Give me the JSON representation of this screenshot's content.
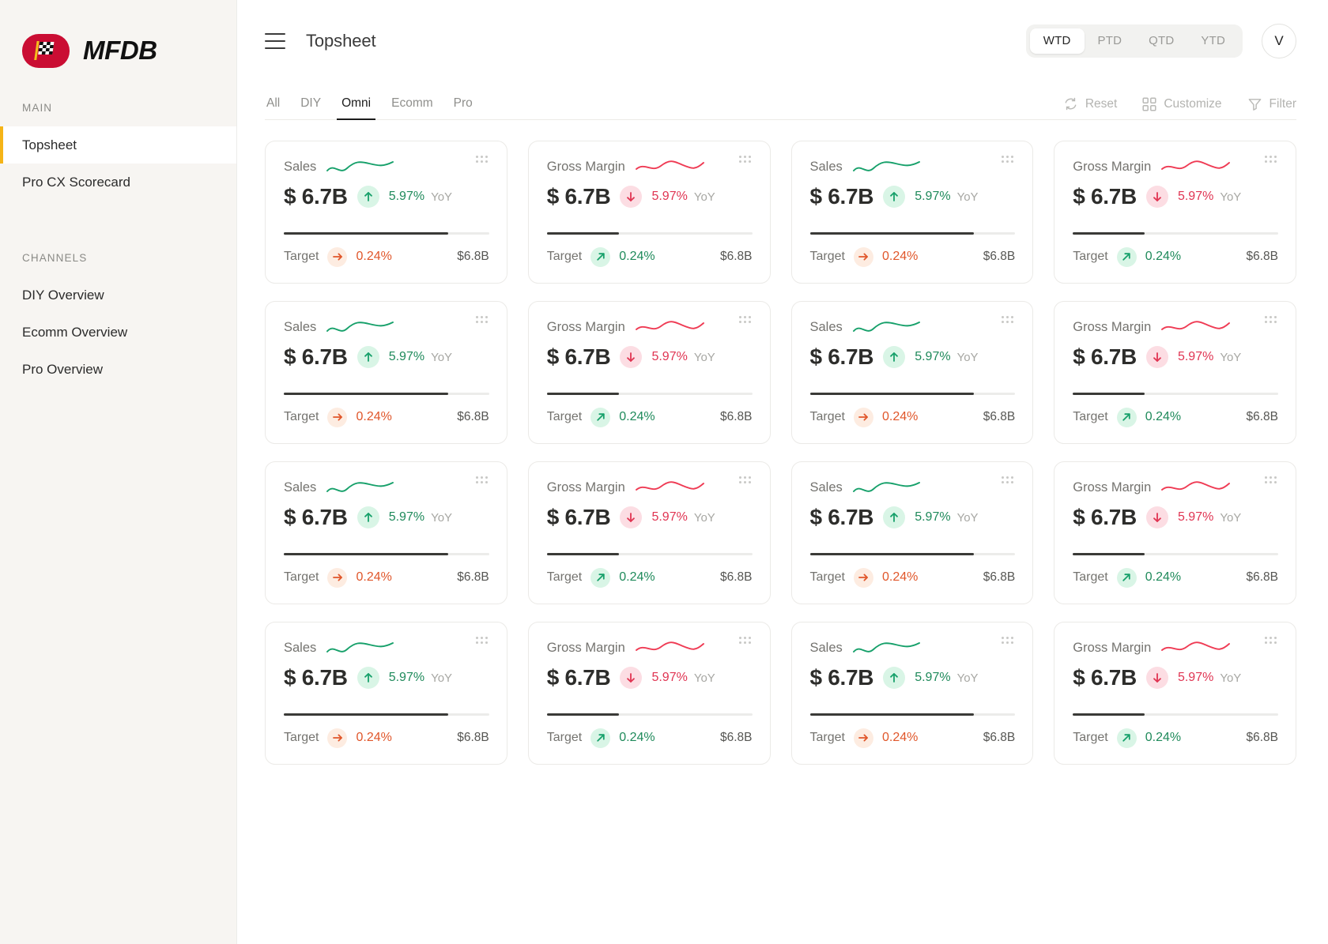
{
  "sidebar": {
    "brand": {
      "name": "MFDB",
      "logo_icon": "checkered-flag-icon",
      "logo_color": "#ca0d33"
    },
    "sections": [
      {
        "label": "MAIN",
        "items": [
          {
            "label": "Topsheet",
            "active": true
          },
          {
            "label": "Pro CX Scorecard",
            "active": false
          }
        ]
      },
      {
        "label": "CHANNELS",
        "items": [
          {
            "label": "DIY Overview",
            "active": false
          },
          {
            "label": "Ecomm Overview",
            "active": false
          },
          {
            "label": "Pro Overview",
            "active": false
          }
        ]
      }
    ],
    "active_accent": "#f5b417"
  },
  "header": {
    "menu_icon": "hamburger-icon",
    "title": "Topsheet",
    "period_options": [
      "WTD",
      "PTD",
      "QTD",
      "YTD"
    ],
    "period_selected": "WTD",
    "avatar_initial": "V"
  },
  "tabs": {
    "items": [
      "All",
      "DIY",
      "Omni",
      "Ecomm",
      "Pro"
    ],
    "selected": "Omni"
  },
  "toolbar": {
    "reset_label": "Reset",
    "customize_label": "Customize",
    "filter_label": "Filter"
  },
  "colors": {
    "positive": "#1f8a5b",
    "negative": "#e03452",
    "warning": "#e0562a",
    "bar": "#3a3a37"
  },
  "cards": [
    {
      "label": "Sales",
      "value": "$ 6.7B",
      "delta": "5.97%",
      "delta_dir": "up",
      "yoy": "YoY",
      "spark": "up",
      "target_label": "Target",
      "target_delta": "0.24%",
      "target_dir": "flat",
      "target_value": "$6.8B",
      "progress": 80
    },
    {
      "label": "Gross Margin",
      "value": "$ 6.7B",
      "delta": "5.97%",
      "delta_dir": "down",
      "yoy": "YoY",
      "spark": "down",
      "target_label": "Target",
      "target_delta": "0.24%",
      "target_dir": "upright",
      "target_value": "$6.8B",
      "progress": 35
    },
    {
      "label": "Sales",
      "value": "$ 6.7B",
      "delta": "5.97%",
      "delta_dir": "up",
      "yoy": "YoY",
      "spark": "up",
      "target_label": "Target",
      "target_delta": "0.24%",
      "target_dir": "flat",
      "target_value": "$6.8B",
      "progress": 80
    },
    {
      "label": "Gross Margin",
      "value": "$ 6.7B",
      "delta": "5.97%",
      "delta_dir": "down",
      "yoy": "YoY",
      "spark": "down",
      "target_label": "Target",
      "target_delta": "0.24%",
      "target_dir": "upright",
      "target_value": "$6.8B",
      "progress": 35
    },
    {
      "label": "Sales",
      "value": "$ 6.7B",
      "delta": "5.97%",
      "delta_dir": "up",
      "yoy": "YoY",
      "spark": "up",
      "target_label": "Target",
      "target_delta": "0.24%",
      "target_dir": "flat",
      "target_value": "$6.8B",
      "progress": 80
    },
    {
      "label": "Gross Margin",
      "value": "$ 6.7B",
      "delta": "5.97%",
      "delta_dir": "down",
      "yoy": "YoY",
      "spark": "down",
      "target_label": "Target",
      "target_delta": "0.24%",
      "target_dir": "upright",
      "target_value": "$6.8B",
      "progress": 35
    },
    {
      "label": "Sales",
      "value": "$ 6.7B",
      "delta": "5.97%",
      "delta_dir": "up",
      "yoy": "YoY",
      "spark": "up",
      "target_label": "Target",
      "target_delta": "0.24%",
      "target_dir": "flat",
      "target_value": "$6.8B",
      "progress": 80
    },
    {
      "label": "Gross Margin",
      "value": "$ 6.7B",
      "delta": "5.97%",
      "delta_dir": "down",
      "yoy": "YoY",
      "spark": "down",
      "target_label": "Target",
      "target_delta": "0.24%",
      "target_dir": "upright",
      "target_value": "$6.8B",
      "progress": 35
    },
    {
      "label": "Sales",
      "value": "$ 6.7B",
      "delta": "5.97%",
      "delta_dir": "up",
      "yoy": "YoY",
      "spark": "up",
      "target_label": "Target",
      "target_delta": "0.24%",
      "target_dir": "flat",
      "target_value": "$6.8B",
      "progress": 80
    },
    {
      "label": "Gross Margin",
      "value": "$ 6.7B",
      "delta": "5.97%",
      "delta_dir": "down",
      "yoy": "YoY",
      "spark": "down",
      "target_label": "Target",
      "target_delta": "0.24%",
      "target_dir": "upright",
      "target_value": "$6.8B",
      "progress": 35
    },
    {
      "label": "Sales",
      "value": "$ 6.7B",
      "delta": "5.97%",
      "delta_dir": "up",
      "yoy": "YoY",
      "spark": "up",
      "target_label": "Target",
      "target_delta": "0.24%",
      "target_dir": "flat",
      "target_value": "$6.8B",
      "progress": 80
    },
    {
      "label": "Gross Margin",
      "value": "$ 6.7B",
      "delta": "5.97%",
      "delta_dir": "down",
      "yoy": "YoY",
      "spark": "down",
      "target_label": "Target",
      "target_delta": "0.24%",
      "target_dir": "upright",
      "target_value": "$6.8B",
      "progress": 35
    },
    {
      "label": "Sales",
      "value": "$ 6.7B",
      "delta": "5.97%",
      "delta_dir": "up",
      "yoy": "YoY",
      "spark": "up",
      "target_label": "Target",
      "target_delta": "0.24%",
      "target_dir": "flat",
      "target_value": "$6.8B",
      "progress": 80
    },
    {
      "label": "Gross Margin",
      "value": "$ 6.7B",
      "delta": "5.97%",
      "delta_dir": "down",
      "yoy": "YoY",
      "spark": "down",
      "target_label": "Target",
      "target_delta": "0.24%",
      "target_dir": "upright",
      "target_value": "$6.8B",
      "progress": 35
    },
    {
      "label": "Sales",
      "value": "$ 6.7B",
      "delta": "5.97%",
      "delta_dir": "up",
      "yoy": "YoY",
      "spark": "up",
      "target_label": "Target",
      "target_delta": "0.24%",
      "target_dir": "flat",
      "target_value": "$6.8B",
      "progress": 80
    },
    {
      "label": "Gross Margin",
      "value": "$ 6.7B",
      "delta": "5.97%",
      "delta_dir": "down",
      "yoy": "YoY",
      "spark": "down",
      "target_label": "Target",
      "target_delta": "0.24%",
      "target_dir": "upright",
      "target_value": "$6.8B",
      "progress": 35
    }
  ]
}
